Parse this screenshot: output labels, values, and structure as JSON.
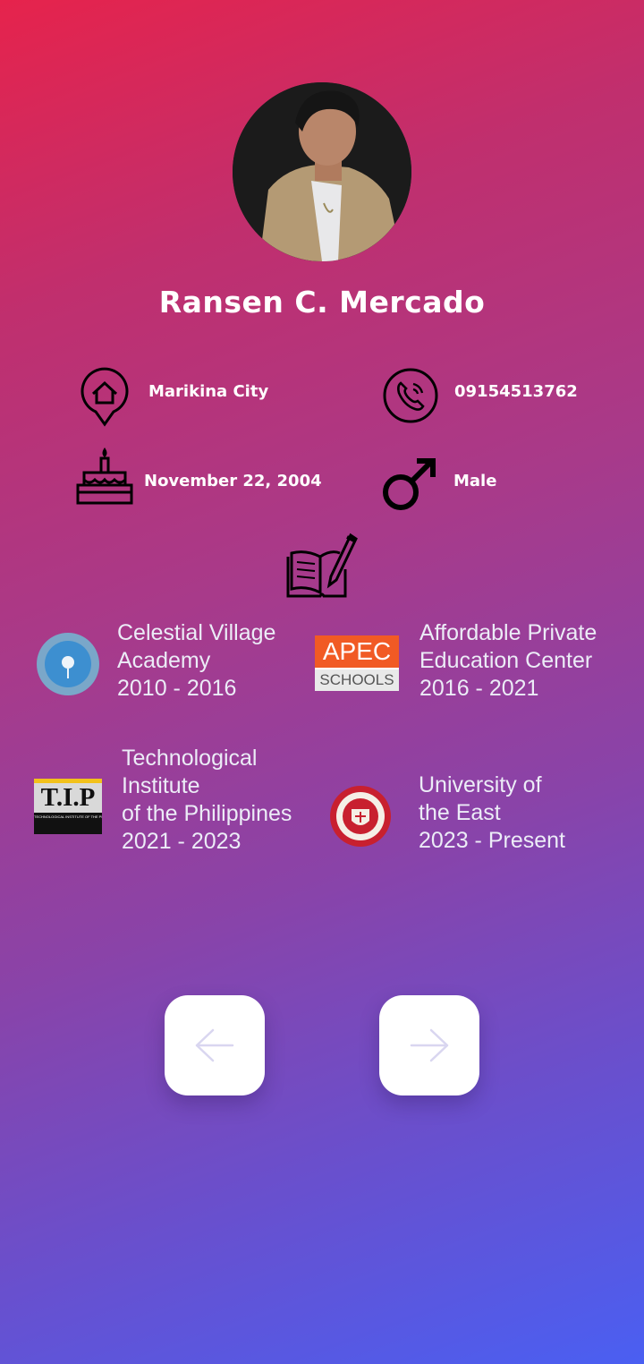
{
  "profile": {
    "name": "Ransen C. Mercado"
  },
  "info": {
    "address": "Marikina City",
    "phone": "09154513762",
    "birthday": "November 22, 2004",
    "gender": "Male"
  },
  "icons": {
    "address": "home-pin-icon",
    "phone": "phone-icon",
    "birthday": "birthday-cake-icon",
    "gender": "male-symbol-icon",
    "education": "book-pencil-icon",
    "back": "arrow-left-icon",
    "next": "arrow-right-icon"
  },
  "schools": [
    {
      "lines": [
        "Celestial Village",
        "Academy",
        "2010 - 2016"
      ],
      "logo": "Celestial Village Academy seal"
    },
    {
      "lines": [
        "Affordable Private",
        "Education Center",
        "2016 - 2021"
      ],
      "logo_top": "APEC",
      "logo_bottom": "SCHOOLS"
    },
    {
      "lines": [
        "Technological",
        "Institute",
        "of the Philippines",
        "2021 - 2023"
      ],
      "logo": "T.I.P",
      "logo_sub": "TECHNOLOGICAL INSTITUTE OF THE PHILIPPINES"
    },
    {
      "lines": [
        "University of",
        "the East",
        "2023 - Present"
      ],
      "logo": "University of the East seal"
    }
  ],
  "colors": {
    "gradient_top": "#e6234c",
    "gradient_bottom": "#4a5ff2",
    "apec_orange": "#f15a24",
    "ue_red": "#c8202f",
    "arrow": "#d9d6f0"
  }
}
